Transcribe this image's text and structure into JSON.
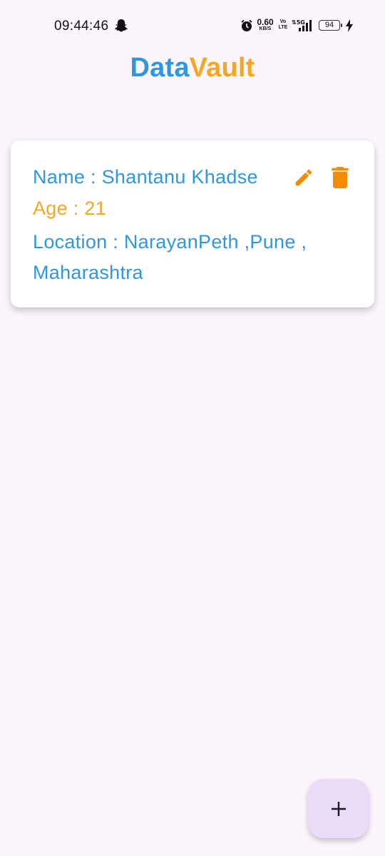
{
  "status_bar": {
    "time": "09:44:46",
    "net_speed_value": "0.60",
    "net_speed_unit": "KB/S",
    "volte_top": "Vo",
    "volte_bottom": "LTE",
    "battery_level": "94",
    "icons": [
      "snapchat-ghost-icon",
      "alarm-icon",
      "signal-5g-icon",
      "battery-icon",
      "charging-bolt-icon"
    ]
  },
  "app": {
    "title_part1": "Data",
    "title_part2": "Vault",
    "title_colors": {
      "part1": "#2f96e0",
      "part2": "#f5a623"
    }
  },
  "records": [
    {
      "name_line": "Name : Shantanu Khadse",
      "age_line": "Age : 21",
      "location_line": "Location : NarayanPeth ,Pune , Maharashtra",
      "actions": [
        "edit-icon",
        "delete-icon"
      ]
    }
  ],
  "fab": {
    "icon": "plus-icon",
    "color": "#eadcf9"
  },
  "colors": {
    "accent_blue": "#2f96e0",
    "accent_orange": "#f5a623",
    "icon_orange": "#f58b00",
    "background": "#fcf5fd"
  }
}
